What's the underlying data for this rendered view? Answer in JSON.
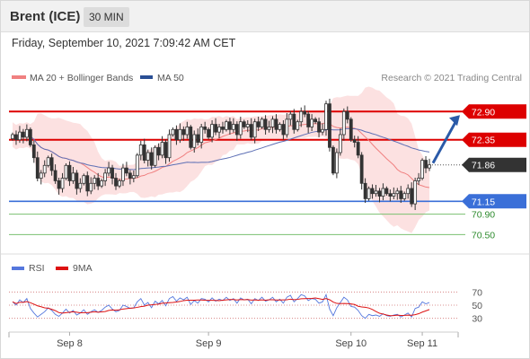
{
  "header": {
    "instrument": "Brent (ICE)",
    "timeframe": "30 MIN"
  },
  "timestamp": "Friday, September 10, 2021 7:09:42 AM CET",
  "colors": {
    "resistance": "#dd0000",
    "support": "#3a6fd8",
    "pivot_green": "#7ac070",
    "bollinger_fill": "#fcdcdc",
    "ma20": "#f08080",
    "ma50": "#5d6fb5",
    "candle": "#333333",
    "forecast_arrow": "#2a5aa8",
    "rsi": "#5577dd",
    "rsi_ma": "#dd1111"
  },
  "chart_data": [
    {
      "type": "candlestick",
      "legend": [
        {
          "label": "MA 20 + Bollinger Bands",
          "color": "#f08080"
        },
        {
          "label": "MA 50",
          "color": "#2a4f95"
        }
      ],
      "watermark": "Research © 2021 Trading Central",
      "ylim": [
        70.35,
        73.15
      ],
      "x_ticks": [
        {
          "label": "Sep 8",
          "index": 16
        },
        {
          "label": "Sep 9",
          "index": 55
        },
        {
          "label": "Sep 10",
          "index": 95
        },
        {
          "label": "Sep 11",
          "index": 115
        }
      ],
      "horizontal_levels": [
        {
          "label": "72.90",
          "value": 72.9,
          "kind": "resistance"
        },
        {
          "label": "72.35",
          "value": 72.35,
          "kind": "resistance"
        },
        {
          "label": "71.86",
          "value": 71.86,
          "kind": "last"
        },
        {
          "label": "71.15",
          "value": 71.15,
          "kind": "support"
        },
        {
          "label": "70.90",
          "value": 70.9,
          "kind": "pivot"
        },
        {
          "label": "70.50",
          "value": 70.5,
          "kind": "pivot"
        }
      ],
      "close": [
        72.45,
        72.35,
        72.5,
        72.4,
        72.55,
        72.25,
        72.0,
        71.6,
        71.7,
        71.85,
        72.0,
        71.75,
        71.55,
        71.4,
        71.6,
        71.85,
        71.55,
        71.7,
        71.4,
        71.5,
        71.65,
        71.35,
        71.5,
        71.6,
        71.45,
        71.55,
        71.7,
        71.8,
        71.6,
        71.45,
        71.55,
        71.8,
        71.7,
        71.6,
        71.65,
        72.05,
        72.25,
        71.95,
        72.1,
        71.85,
        72.2,
        72.05,
        72.3,
        72.0,
        72.45,
        72.55,
        72.35,
        72.55,
        72.45,
        72.6,
        72.2,
        72.45,
        72.3,
        72.6,
        72.55,
        72.4,
        72.65,
        72.5,
        72.6,
        72.55,
        72.7,
        72.55,
        72.65,
        72.45,
        72.7,
        72.6,
        72.65,
        72.4,
        72.7,
        72.6,
        72.75,
        72.55,
        72.6,
        72.75,
        72.55,
        72.65,
        72.45,
        72.75,
        72.85,
        72.55,
        72.7,
        72.9,
        72.85,
        72.6,
        72.75,
        72.7,
        72.5,
        72.55,
        73.05,
        72.2,
        71.7,
        72.1,
        72.45,
        72.9,
        72.75,
        72.35,
        72.3,
        72.05,
        71.5,
        71.2,
        71.4,
        71.3,
        71.35,
        71.25,
        71.4,
        71.3,
        71.25,
        71.3,
        71.35,
        71.2,
        71.3,
        71.4,
        71.1,
        71.55,
        71.6,
        71.95,
        71.8,
        71.86
      ],
      "rsi": {
        "series": [
          {
            "name": "RSI",
            "color": "#5577dd"
          },
          {
            "name": "9MA",
            "color": "#dd1111"
          }
        ],
        "levels": [
          70,
          50,
          30
        ],
        "ylim": [
          20,
          80
        ],
        "rsi": [
          55,
          50,
          58,
          54,
          60,
          45,
          38,
          32,
          36,
          40,
          46,
          42,
          36,
          33,
          38,
          44,
          38,
          42,
          35,
          38,
          43,
          36,
          40,
          43,
          39,
          42,
          47,
          50,
          44,
          40,
          42,
          50,
          48,
          45,
          46,
          55,
          60,
          50,
          54,
          46,
          56,
          52,
          57,
          49,
          60,
          63,
          56,
          61,
          58,
          62,
          51,
          57,
          53,
          60,
          59,
          55,
          61,
          56,
          59,
          57,
          62,
          57,
          60,
          53,
          61,
          58,
          59,
          52,
          60,
          57,
          62,
          56,
          58,
          62,
          55,
          59,
          53,
          62,
          65,
          55,
          60,
          66,
          64,
          57,
          60,
          59,
          53,
          55,
          66,
          44,
          34,
          46,
          54,
          62,
          58,
          48,
          47,
          42,
          34,
          30,
          36,
          34,
          35,
          33,
          37,
          34,
          33,
          35,
          36,
          32,
          35,
          38,
          32,
          45,
          47,
          55,
          52,
          54
        ]
      }
    }
  ]
}
